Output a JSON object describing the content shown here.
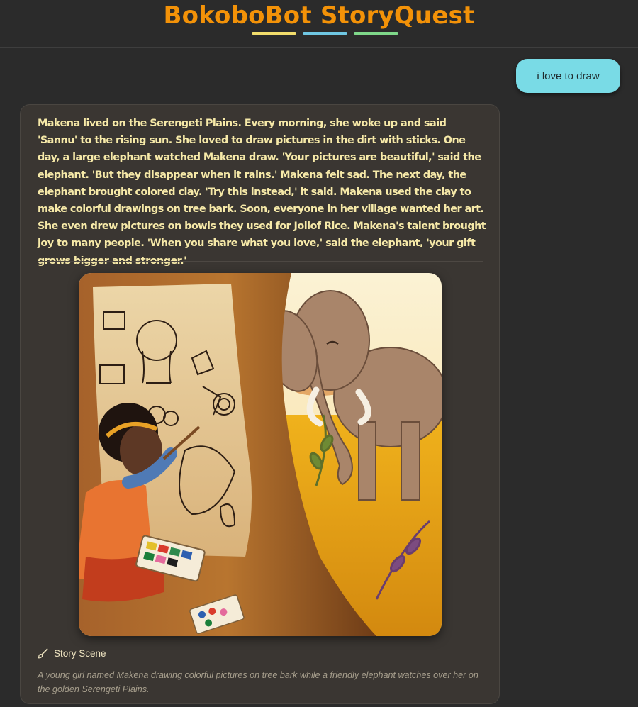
{
  "header": {
    "title": "BokoboBot StoryQuest",
    "title_color": "#f39208",
    "accent_colors": [
      "#f2dd6c",
      "#6fc7e3",
      "#7fd88a"
    ]
  },
  "chat": {
    "user_message": "i love to draw",
    "user_bubble_color": "#79dbe6"
  },
  "story": {
    "text": "Makena lived on the Serengeti Plains. Every morning, she woke up and said 'Sannu' to the rising sun. She loved to draw pictures in the dirt with sticks. One day, a large elephant watched Makena draw. 'Your pictures are beautiful,' said the elephant. 'But they disappear when it rains.' Makena felt sad. The next day, the elephant brought colored clay. 'Try this instead,' it said. Makena used the clay to make colorful drawings on tree bark. Soon, everyone in her village wanted her art. She even drew pictures on bowls they used for Jollof Rice. Makena's talent brought joy to many people. 'When you share what you love,' said the elephant, 'your gift grows bigger and stronger.'",
    "text_color": "#f6e9a8",
    "scene_label": "Story Scene",
    "scene_icon": "paintbrush-icon",
    "scene_caption": "A young girl named Makena drawing colorful pictures on tree bark while a friendly elephant watches over her on the golden Serengeti Plains."
  }
}
